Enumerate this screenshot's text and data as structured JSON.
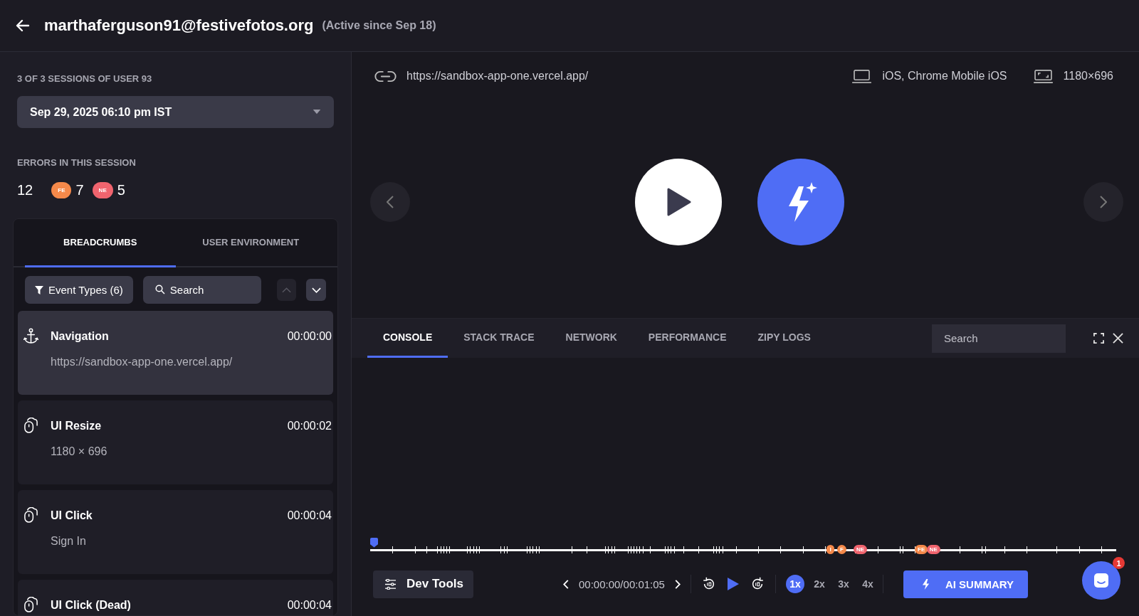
{
  "header": {
    "title": "marthaferguson91@festivefotos.org",
    "subtitle": "(Active since Sep 18)"
  },
  "sidebar": {
    "sessions_label": "3 OF 3 SESSIONS OF USER 93",
    "session_select": {
      "value": "Sep 29, 2025 06:10 pm IST"
    },
    "errors_label": "ERRORS IN THIS SESSION",
    "errors_total": "12",
    "error_counts": [
      {
        "label": "FE",
        "count": "7",
        "color": "#f5894a"
      },
      {
        "label": "NE",
        "count": "5",
        "color": "#f0646e"
      }
    ],
    "tabs": [
      {
        "label": "BREADCRUMBS",
        "selected": true
      },
      {
        "label": "USER ENVIRONMENT",
        "selected": false
      }
    ],
    "filter_button": "Event Types (6)",
    "search": {
      "placeholder": "Search"
    },
    "nav_up": {
      "disabled": true
    },
    "nav_down": {
      "disabled": false
    },
    "breadcrumbs": [
      {
        "kind": "navigation",
        "title": "Navigation",
        "time": "00:00:00",
        "detail": "https://sandbox-app-one.vercel.app/",
        "selected": true
      },
      {
        "kind": "mouse",
        "title": "UI Resize",
        "time": "00:00:02",
        "detail": "1180 × 696",
        "selected": false
      },
      {
        "kind": "mouse",
        "title": "UI Click",
        "time": "00:00:04",
        "detail": "Sign In",
        "selected": false
      },
      {
        "kind": "mouse",
        "title": "UI Click (Dead)",
        "time": "00:00:04",
        "selected": false
      }
    ]
  },
  "player": {
    "url": "https://sandbox-app-one.vercel.app/",
    "device": "iOS, Chrome Mobile iOS",
    "resolution": "1180×696"
  },
  "devtools": {
    "tabs": [
      {
        "label": "CONSOLE",
        "selected": true
      },
      {
        "label": "STACK TRACE",
        "selected": false
      },
      {
        "label": "NETWORK",
        "selected": false
      },
      {
        "label": "PERFORMANCE",
        "selected": false
      },
      {
        "label": "ZIPY LOGS",
        "selected": false
      }
    ],
    "search": {
      "placeholder": "Search"
    }
  },
  "timeline": {
    "level": 0.0,
    "markers": [
      {
        "label": "I",
        "kind": "fe"
      },
      {
        "label": "F",
        "kind": "fe"
      },
      {
        "label": "NE",
        "kind": "ne"
      },
      {
        "label": "FE",
        "kind": "fe"
      },
      {
        "label": "NE",
        "kind": "ne"
      }
    ]
  },
  "controls": {
    "dev_tools": "Dev Tools",
    "time": "00:00:00/00:01:05",
    "speeds": [
      {
        "label": "1x",
        "selected": true
      },
      {
        "label": "2x",
        "selected": false
      },
      {
        "label": "3x",
        "selected": false
      },
      {
        "label": "4x",
        "selected": false
      }
    ],
    "ai_summary": "AI SUMMARY",
    "chat_badge": "1"
  }
}
